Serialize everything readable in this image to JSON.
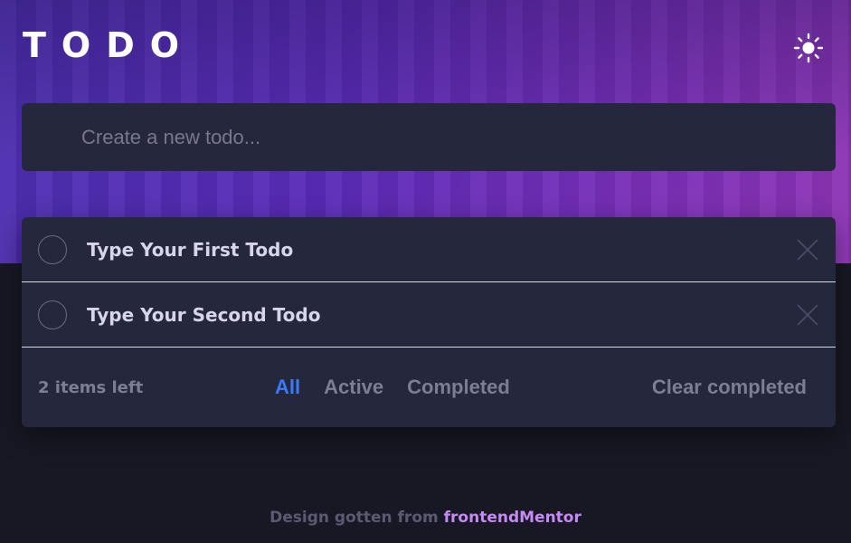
{
  "header": {
    "title": "TODO",
    "theme_icon": "sun-icon"
  },
  "new_todo": {
    "placeholder": "Create a new todo..."
  },
  "todos": [
    {
      "text": "Type Your First Todo",
      "completed": false
    },
    {
      "text": "Type Your Second Todo",
      "completed": false
    }
  ],
  "footer": {
    "items_left": "2 items left",
    "filters": [
      "All",
      "Active",
      "Completed"
    ],
    "active_filter": "All",
    "clear_label": "Clear completed"
  },
  "credit": {
    "prefix": "Design gotten from",
    "link": "frontendMentor"
  },
  "colors": {
    "background": "#181824",
    "card": "#25273c",
    "accent": "#3a7bfd",
    "link": "#c58af5"
  }
}
